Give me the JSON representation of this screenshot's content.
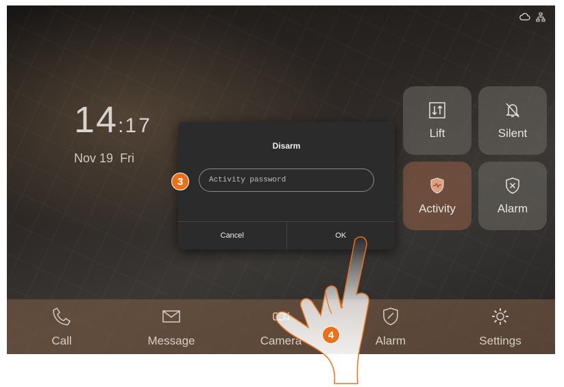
{
  "status_bar": {
    "icons": [
      "cloud-icon",
      "network-icon"
    ]
  },
  "clock": {
    "hours": "14",
    "separator": ":",
    "minutes": "17",
    "date": "Nov 19",
    "weekday": "Fri"
  },
  "tiles": {
    "lift": {
      "label": "Lift",
      "icon": "lift-icon"
    },
    "silent": {
      "label": "Silent",
      "icon": "silent-bell-icon"
    },
    "activity": {
      "label": "Activity",
      "icon": "shield-activity-icon"
    },
    "alarm": {
      "label": "Alarm",
      "icon": "shield-x-icon"
    }
  },
  "dock": {
    "call": {
      "label": "Call",
      "icon": "phone-icon"
    },
    "message": {
      "label": "Message",
      "icon": "envelope-icon"
    },
    "camera": {
      "label": "Camera",
      "icon": "camera-icon"
    },
    "alarm": {
      "label": "Alarm",
      "icon": "shield-icon"
    },
    "settings": {
      "label": "Settings",
      "icon": "gear-icon"
    }
  },
  "dialog": {
    "title": "Disarm",
    "password_placeholder": "Activity password",
    "cancel_label": "Cancel",
    "ok_label": "OK"
  },
  "annotations": {
    "step_field": "3",
    "step_ok": "4"
  },
  "colors": {
    "accent": "#e8711c",
    "dialog_bg": "#2b2b2b",
    "dock_bg": "#82604a"
  }
}
